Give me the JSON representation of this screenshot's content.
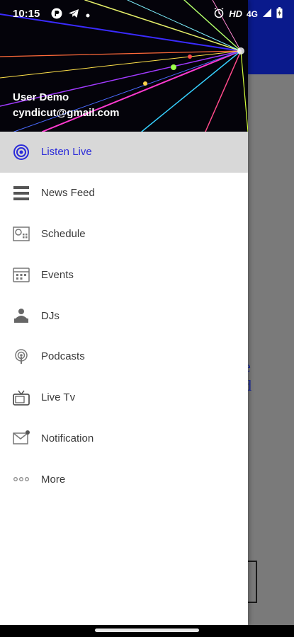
{
  "status_bar": {
    "time": "10:15",
    "hd": "HD",
    "network": "4G"
  },
  "drawer": {
    "user": {
      "name": "User Demo",
      "email": "cyndicut@gmail.com"
    },
    "items": [
      {
        "label": "Listen Live",
        "icon": "radio-waves-icon",
        "active": true
      },
      {
        "label": "News Feed",
        "icon": "list-icon"
      },
      {
        "label": "Schedule",
        "icon": "schedule-icon"
      },
      {
        "label": "Events",
        "icon": "calendar-icon"
      },
      {
        "label": "DJs",
        "icon": "dj-icon"
      },
      {
        "label": "Podcasts",
        "icon": "podcast-icon"
      },
      {
        "label": "Live Tv",
        "icon": "tv-icon"
      },
      {
        "label": "Notification",
        "icon": "mail-icon"
      },
      {
        "label": "More",
        "icon": "more-dots-icon"
      }
    ]
  },
  "background": {
    "peek_text": "ne\nnd\n a"
  },
  "colors": {
    "active_label": "#2b2bd9",
    "appbar": "#0a1a8c",
    "active_bg": "#d8d8d8"
  }
}
